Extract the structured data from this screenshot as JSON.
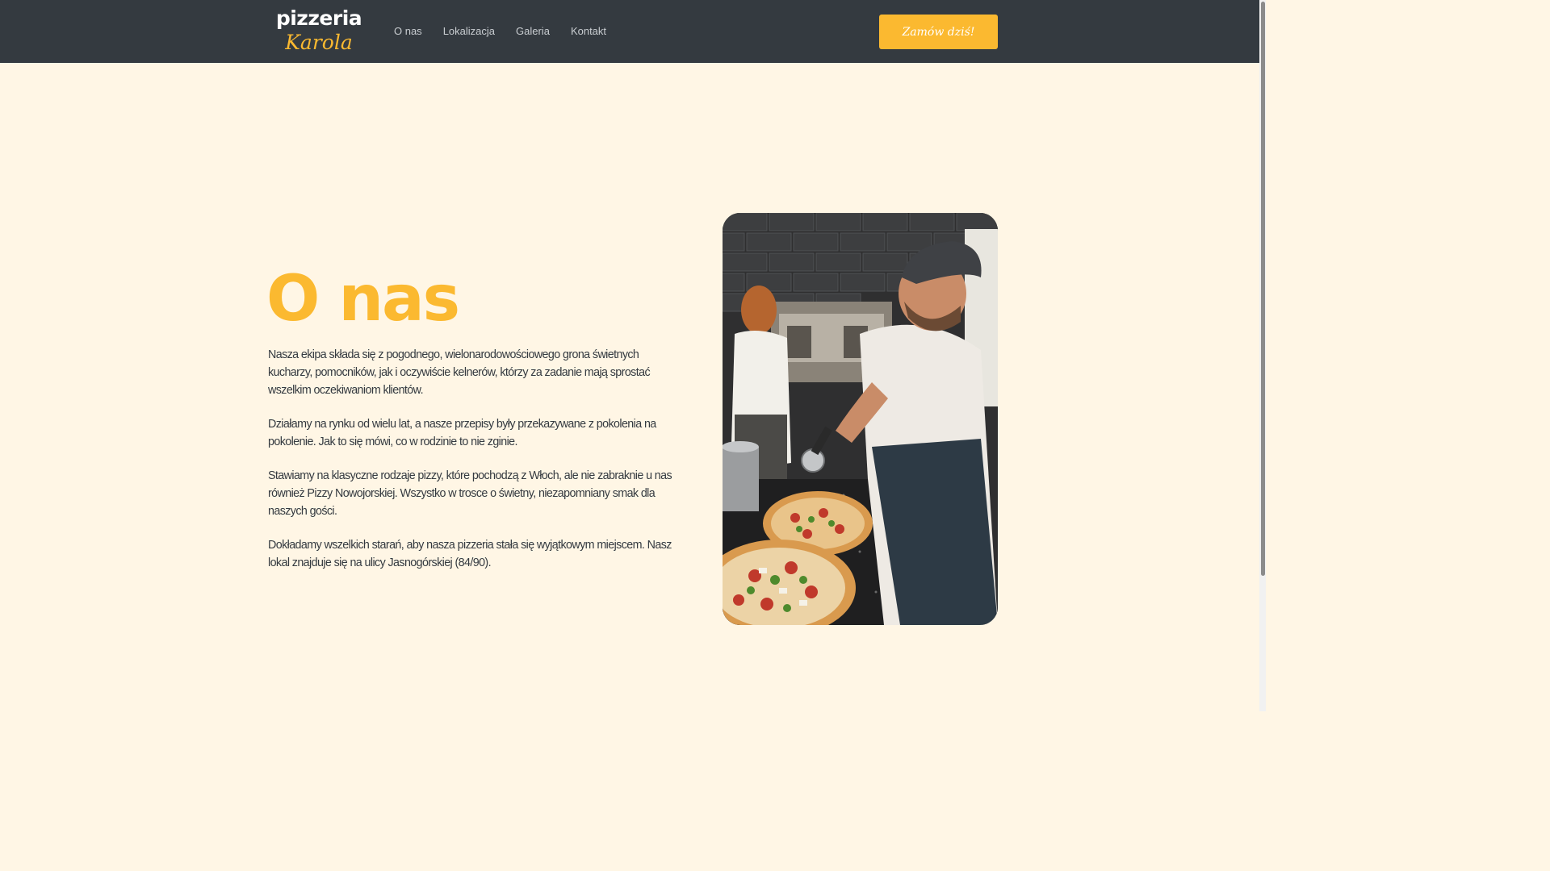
{
  "header": {
    "logo": {
      "line1": "pizzeria",
      "line2": "Karola"
    },
    "nav": [
      {
        "label": "O nas"
      },
      {
        "label": "Lokalizacja"
      },
      {
        "label": "Galeria"
      },
      {
        "label": "Kontakt"
      }
    ],
    "order_button": "Zamów dziś!"
  },
  "about": {
    "title": "O nas",
    "paragraphs": [
      "Nasza ekipa składa się z pogodnego, wielonarodowościowego grona świetnych kucharzy, pomocników, jak i oczywiście kelnerów, którzy za zadanie mają sprostać wszelkim oczekiwaniom klientów.",
      "Działamy na rynku od wielu lat, a nasze przepisy były przekazywane z pokolenia na pokolenie. Jak to się mówi, co w rodzinie to nie zginie.",
      "Stawiamy na klasyczne rodzaje pizzy, które pochodzą z Włoch, ale nie zabraknie u nas również Pizzy Nowojorskiej. Wszystko w trosce o świetny, niezapomniany smak dla naszych gości.",
      "Dokładamy wszelkich starań, aby nasza pizzeria stała się wyjątkowym miejscem. Nasz lokal znajduje się na ulicy Jasnogórskiej (84/90)."
    ]
  },
  "colors": {
    "navbar": "#343a40",
    "accent": "#fbb930",
    "background": "#fff6e5",
    "text": "#343a40"
  }
}
